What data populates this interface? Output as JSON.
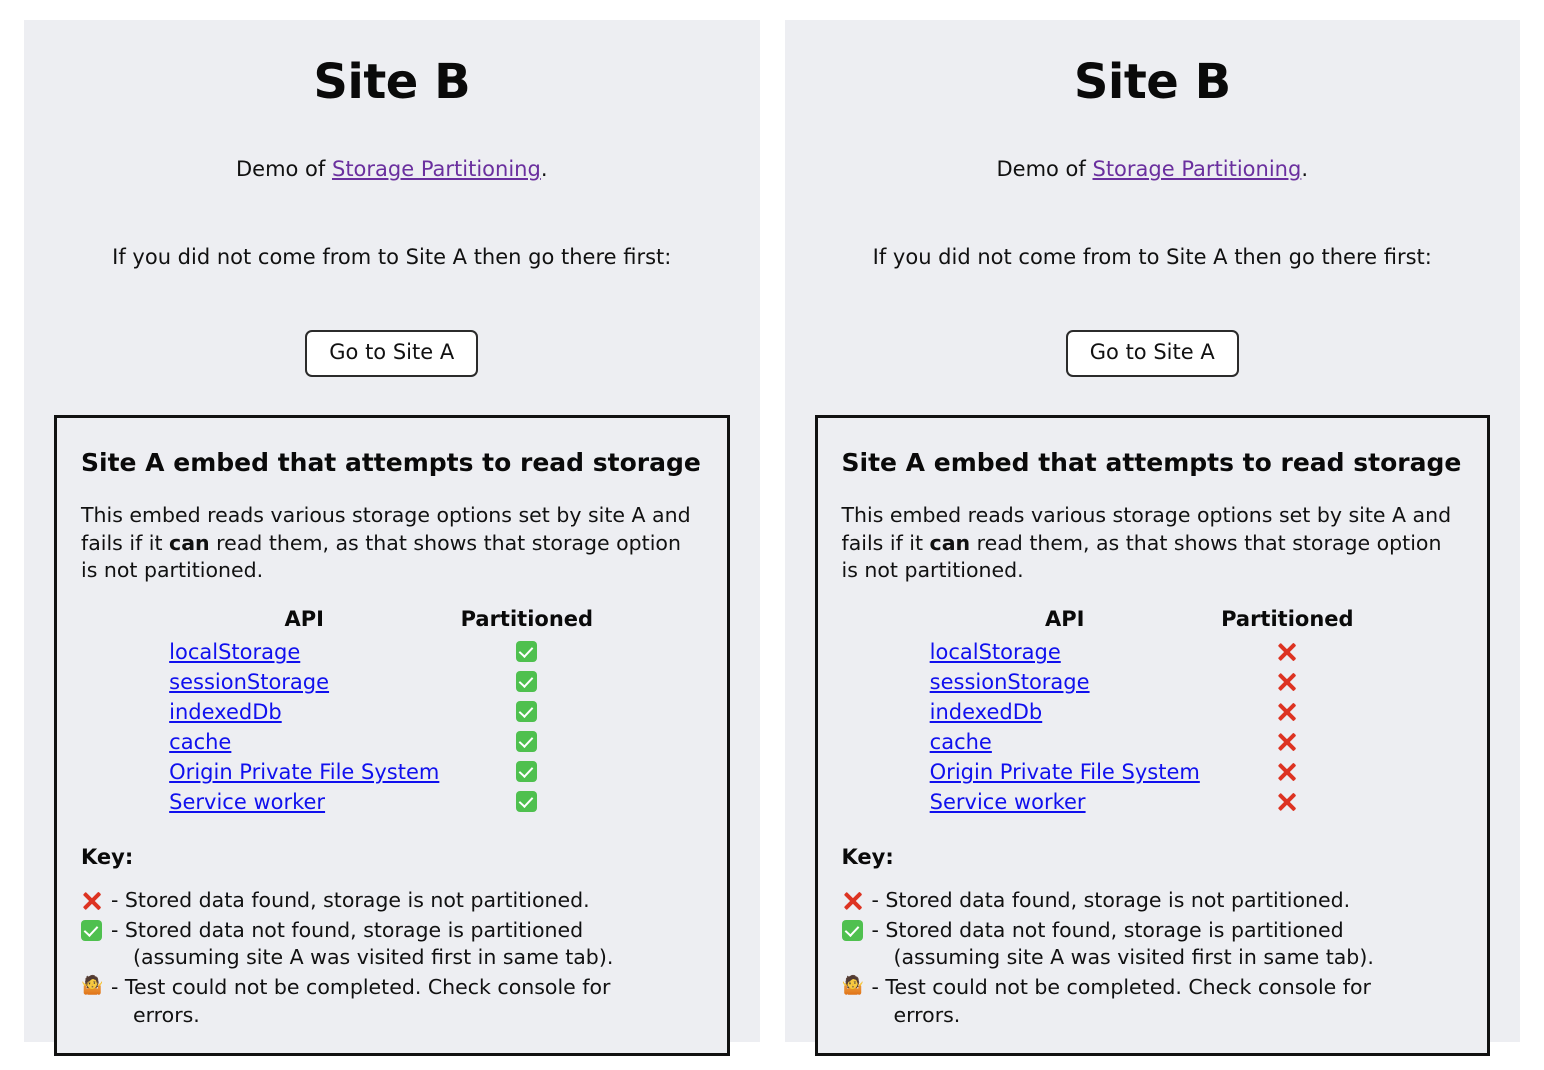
{
  "colors": {
    "page_background": "#ffffff",
    "panel_background": "#edeef2",
    "box_border": "#111111",
    "link": "#1010ee",
    "visited_link": "#6a2f9e",
    "check_green": "#4fc04f",
    "cross_red": "#dd3322"
  },
  "panels": [
    {
      "title": "Site B",
      "demo": {
        "prefix": "Demo of ",
        "link_label": "Storage Partitioning",
        "suffix": "."
      },
      "instruction": "If you did not come from to Site A then go there first:",
      "button_label": "Go to Site A",
      "embed": {
        "heading": "Site A embed that attempts to read storage",
        "description_part1": "This embed reads various storage options set by site A and fails if it ",
        "description_emphasis": "can",
        "description_part2": " read them, as that shows that storage option is not partitioned.",
        "table": {
          "headers": [
            "API",
            "Partitioned"
          ],
          "rows": [
            {
              "api": "localStorage",
              "status": "check"
            },
            {
              "api": "sessionStorage",
              "status": "check"
            },
            {
              "api": "indexedDb",
              "status": "check"
            },
            {
              "api": "cache",
              "status": "check"
            },
            {
              "api": "Origin Private File System",
              "status": "check"
            },
            {
              "api": "Service worker",
              "status": "check"
            }
          ]
        },
        "key": {
          "title": "Key:",
          "items": [
            {
              "icon": "cross",
              "text": "- Stored data found, storage is not partitioned.",
              "indent": ""
            },
            {
              "icon": "check",
              "text": "- Stored data not found, storage is partitioned",
              "indent": "(assuming site A was visited first in same tab)."
            },
            {
              "icon": "shrug",
              "text": "- Test could not be completed. Check console for",
              "indent": "errors."
            }
          ]
        }
      }
    },
    {
      "title": "Site B",
      "demo": {
        "prefix": "Demo of ",
        "link_label": "Storage Partitioning",
        "suffix": "."
      },
      "instruction": "If you did not come from to Site A then go there first:",
      "button_label": "Go to Site A",
      "embed": {
        "heading": "Site A embed that attempts to read storage",
        "description_part1": "This embed reads various storage options set by site A and fails if it ",
        "description_emphasis": "can",
        "description_part2": " read them, as that shows that storage option is not partitioned.",
        "table": {
          "headers": [
            "API",
            "Partitioned"
          ],
          "rows": [
            {
              "api": "localStorage",
              "status": "cross"
            },
            {
              "api": "sessionStorage",
              "status": "cross"
            },
            {
              "api": "indexedDb",
              "status": "cross"
            },
            {
              "api": "cache",
              "status": "cross"
            },
            {
              "api": "Origin Private File System",
              "status": "cross"
            },
            {
              "api": "Service worker",
              "status": "cross"
            }
          ]
        },
        "key": {
          "title": "Key:",
          "items": [
            {
              "icon": "cross",
              "text": "- Stored data found, storage is not partitioned.",
              "indent": ""
            },
            {
              "icon": "check",
              "text": "- Stored data not found, storage is partitioned",
              "indent": "(assuming site A was visited first in same tab)."
            },
            {
              "icon": "shrug",
              "text": "- Test could not be completed. Check console for",
              "indent": "errors."
            }
          ]
        }
      }
    }
  ],
  "icons": {
    "check": "white-check-mark",
    "cross": "cross-mark",
    "shrug": "person-shrugging"
  }
}
